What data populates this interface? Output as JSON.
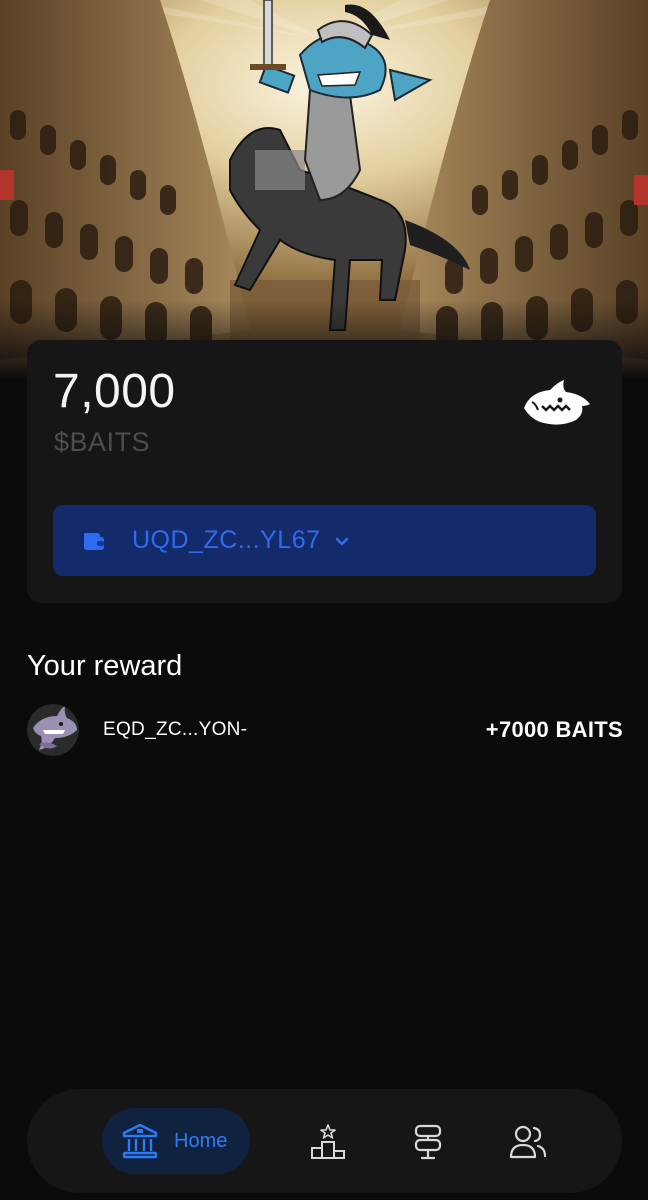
{
  "balance": {
    "amount": "7,000",
    "currency": "$BAITS"
  },
  "wallet": {
    "address": "UQD_ZC...YL67",
    "icon": "wallet-icon",
    "dropdown_icon": "chevron-down-icon"
  },
  "reward": {
    "title": "Your reward",
    "items": [
      {
        "avatar": "shark-avatar",
        "address": "EQD_ZC...YON-",
        "amount": "+7000 BAITS"
      }
    ]
  },
  "nav": {
    "items": [
      {
        "label": "Home",
        "icon": "bank-icon",
        "active": true
      },
      {
        "label": "",
        "icon": "leaderboard-icon",
        "active": false
      },
      {
        "label": "",
        "icon": "signpost-icon",
        "active": false
      },
      {
        "label": "",
        "icon": "users-icon",
        "active": false
      }
    ]
  },
  "colors": {
    "background": "#0b0b0b",
    "card": "#161616",
    "accent_blue": "#2f6bf0",
    "wallet_button": "#142b6b",
    "muted_text": "#4d4d4d"
  }
}
